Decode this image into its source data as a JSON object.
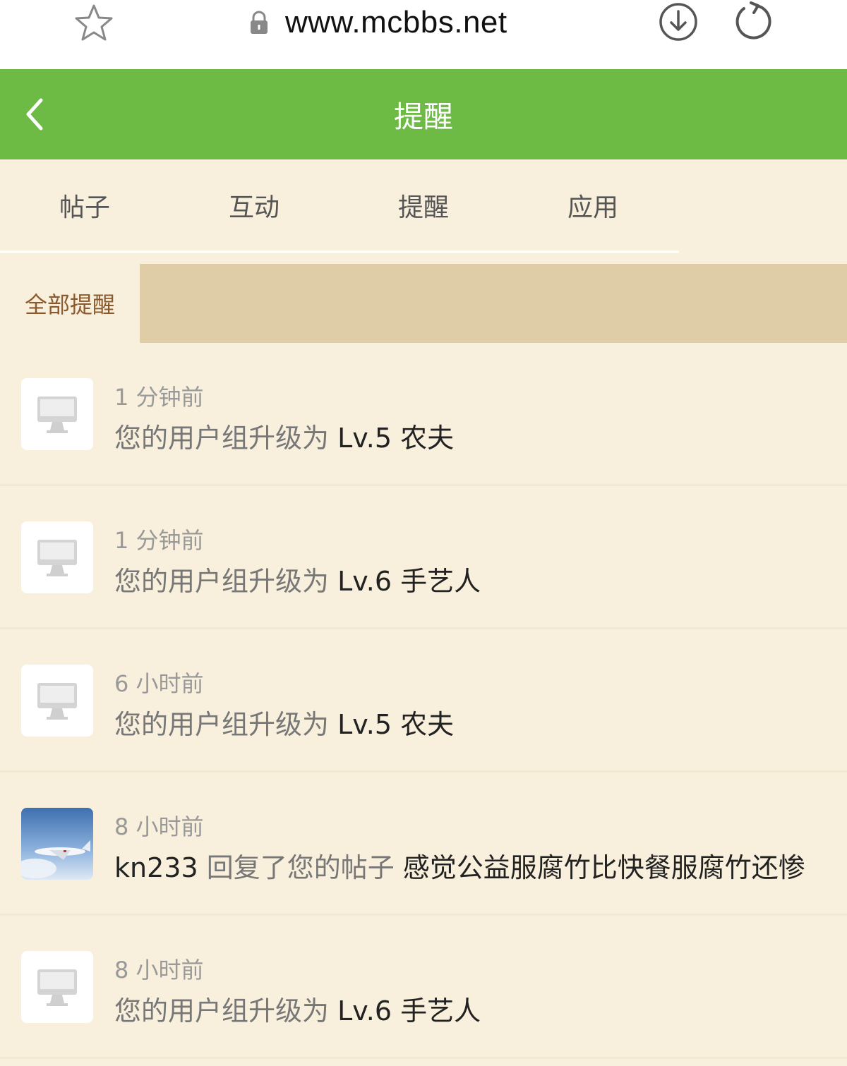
{
  "browser": {
    "url": "www.mcbbs.net"
  },
  "header": {
    "title": "提醒"
  },
  "tabs": [
    {
      "label": "帖子"
    },
    {
      "label": "互动"
    },
    {
      "label": "提醒"
    },
    {
      "label": "应用"
    }
  ],
  "subnav": {
    "active_label": "全部提醒"
  },
  "notifications": [
    {
      "time": "1 分钟前",
      "prefix": "您的用户组升级为 ",
      "highlight": "Lv.5 农夫",
      "avatar": "computer-icon"
    },
    {
      "time": "1 分钟前",
      "prefix": "您的用户组升级为 ",
      "highlight": "Lv.6 手艺人",
      "avatar": "computer-icon"
    },
    {
      "time": "6 小时前",
      "prefix": "您的用户组升级为 ",
      "highlight": "Lv.5 农夫",
      "avatar": "computer-icon"
    },
    {
      "time": "8 小时前",
      "user": "kn233",
      "action": " 回复了您的帖子 ",
      "highlight": "感觉公益服腐竹比快餐服腐竹还惨",
      "avatar": "airplane-photo"
    },
    {
      "time": "8 小时前",
      "prefix": "您的用户组升级为 ",
      "highlight": "Lv.6 手艺人",
      "avatar": "computer-icon"
    }
  ],
  "colors": {
    "header_green": "#6dbb44",
    "page_bg": "#f8f0dc",
    "subnav_bar": "#dfcda8",
    "subnav_text": "#8a5a2c"
  }
}
